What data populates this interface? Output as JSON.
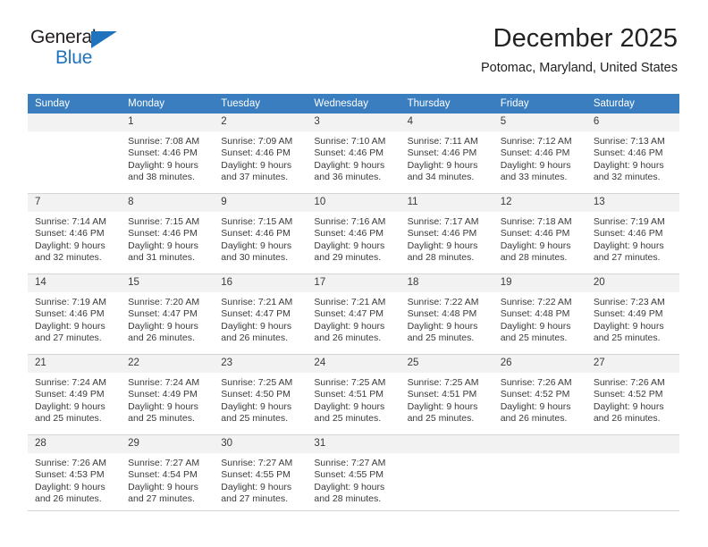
{
  "brand": {
    "name_top": "General",
    "name_bottom": "Blue",
    "triangle_icon": "triangle-icon",
    "color_dark": "#231f20",
    "color_blue": "#1f73bd"
  },
  "header": {
    "month_title": "December 2025",
    "location": "Potomac, Maryland, United States"
  },
  "theme": {
    "header_band": "#3a7ebf",
    "day_number_band": "#f2f2f2",
    "rule": "#d4d4d4",
    "text": "#3a3a3a"
  },
  "weekdays": [
    "Sunday",
    "Monday",
    "Tuesday",
    "Wednesday",
    "Thursday",
    "Friday",
    "Saturday"
  ],
  "labels": {
    "sunrise_prefix": "Sunrise:",
    "sunset_prefix": "Sunset:",
    "daylight_prefix": "Daylight:"
  },
  "weeks": [
    [
      {
        "day": "",
        "sunrise": "",
        "sunset": "",
        "daylight_line1": "",
        "daylight_line2": "",
        "blank": true
      },
      {
        "day": "1",
        "sunrise": "Sunrise: 7:08 AM",
        "sunset": "Sunset: 4:46 PM",
        "daylight_line1": "Daylight: 9 hours",
        "daylight_line2": "and 38 minutes."
      },
      {
        "day": "2",
        "sunrise": "Sunrise: 7:09 AM",
        "sunset": "Sunset: 4:46 PM",
        "daylight_line1": "Daylight: 9 hours",
        "daylight_line2": "and 37 minutes."
      },
      {
        "day": "3",
        "sunrise": "Sunrise: 7:10 AM",
        "sunset": "Sunset: 4:46 PM",
        "daylight_line1": "Daylight: 9 hours",
        "daylight_line2": "and 36 minutes."
      },
      {
        "day": "4",
        "sunrise": "Sunrise: 7:11 AM",
        "sunset": "Sunset: 4:46 PM",
        "daylight_line1": "Daylight: 9 hours",
        "daylight_line2": "and 34 minutes."
      },
      {
        "day": "5",
        "sunrise": "Sunrise: 7:12 AM",
        "sunset": "Sunset: 4:46 PM",
        "daylight_line1": "Daylight: 9 hours",
        "daylight_line2": "and 33 minutes."
      },
      {
        "day": "6",
        "sunrise": "Sunrise: 7:13 AM",
        "sunset": "Sunset: 4:46 PM",
        "daylight_line1": "Daylight: 9 hours",
        "daylight_line2": "and 32 minutes."
      }
    ],
    [
      {
        "day": "7",
        "sunrise": "Sunrise: 7:14 AM",
        "sunset": "Sunset: 4:46 PM",
        "daylight_line1": "Daylight: 9 hours",
        "daylight_line2": "and 32 minutes."
      },
      {
        "day": "8",
        "sunrise": "Sunrise: 7:15 AM",
        "sunset": "Sunset: 4:46 PM",
        "daylight_line1": "Daylight: 9 hours",
        "daylight_line2": "and 31 minutes."
      },
      {
        "day": "9",
        "sunrise": "Sunrise: 7:15 AM",
        "sunset": "Sunset: 4:46 PM",
        "daylight_line1": "Daylight: 9 hours",
        "daylight_line2": "and 30 minutes."
      },
      {
        "day": "10",
        "sunrise": "Sunrise: 7:16 AM",
        "sunset": "Sunset: 4:46 PM",
        "daylight_line1": "Daylight: 9 hours",
        "daylight_line2": "and 29 minutes."
      },
      {
        "day": "11",
        "sunrise": "Sunrise: 7:17 AM",
        "sunset": "Sunset: 4:46 PM",
        "daylight_line1": "Daylight: 9 hours",
        "daylight_line2": "and 28 minutes."
      },
      {
        "day": "12",
        "sunrise": "Sunrise: 7:18 AM",
        "sunset": "Sunset: 4:46 PM",
        "daylight_line1": "Daylight: 9 hours",
        "daylight_line2": "and 28 minutes."
      },
      {
        "day": "13",
        "sunrise": "Sunrise: 7:19 AM",
        "sunset": "Sunset: 4:46 PM",
        "daylight_line1": "Daylight: 9 hours",
        "daylight_line2": "and 27 minutes."
      }
    ],
    [
      {
        "day": "14",
        "sunrise": "Sunrise: 7:19 AM",
        "sunset": "Sunset: 4:46 PM",
        "daylight_line1": "Daylight: 9 hours",
        "daylight_line2": "and 27 minutes."
      },
      {
        "day": "15",
        "sunrise": "Sunrise: 7:20 AM",
        "sunset": "Sunset: 4:47 PM",
        "daylight_line1": "Daylight: 9 hours",
        "daylight_line2": "and 26 minutes."
      },
      {
        "day": "16",
        "sunrise": "Sunrise: 7:21 AM",
        "sunset": "Sunset: 4:47 PM",
        "daylight_line1": "Daylight: 9 hours",
        "daylight_line2": "and 26 minutes."
      },
      {
        "day": "17",
        "sunrise": "Sunrise: 7:21 AM",
        "sunset": "Sunset: 4:47 PM",
        "daylight_line1": "Daylight: 9 hours",
        "daylight_line2": "and 26 minutes."
      },
      {
        "day": "18",
        "sunrise": "Sunrise: 7:22 AM",
        "sunset": "Sunset: 4:48 PM",
        "daylight_line1": "Daylight: 9 hours",
        "daylight_line2": "and 25 minutes."
      },
      {
        "day": "19",
        "sunrise": "Sunrise: 7:22 AM",
        "sunset": "Sunset: 4:48 PM",
        "daylight_line1": "Daylight: 9 hours",
        "daylight_line2": "and 25 minutes."
      },
      {
        "day": "20",
        "sunrise": "Sunrise: 7:23 AM",
        "sunset": "Sunset: 4:49 PM",
        "daylight_line1": "Daylight: 9 hours",
        "daylight_line2": "and 25 minutes."
      }
    ],
    [
      {
        "day": "21",
        "sunrise": "Sunrise: 7:24 AM",
        "sunset": "Sunset: 4:49 PM",
        "daylight_line1": "Daylight: 9 hours",
        "daylight_line2": "and 25 minutes."
      },
      {
        "day": "22",
        "sunrise": "Sunrise: 7:24 AM",
        "sunset": "Sunset: 4:49 PM",
        "daylight_line1": "Daylight: 9 hours",
        "daylight_line2": "and 25 minutes."
      },
      {
        "day": "23",
        "sunrise": "Sunrise: 7:25 AM",
        "sunset": "Sunset: 4:50 PM",
        "daylight_line1": "Daylight: 9 hours",
        "daylight_line2": "and 25 minutes."
      },
      {
        "day": "24",
        "sunrise": "Sunrise: 7:25 AM",
        "sunset": "Sunset: 4:51 PM",
        "daylight_line1": "Daylight: 9 hours",
        "daylight_line2": "and 25 minutes."
      },
      {
        "day": "25",
        "sunrise": "Sunrise: 7:25 AM",
        "sunset": "Sunset: 4:51 PM",
        "daylight_line1": "Daylight: 9 hours",
        "daylight_line2": "and 25 minutes."
      },
      {
        "day": "26",
        "sunrise": "Sunrise: 7:26 AM",
        "sunset": "Sunset: 4:52 PM",
        "daylight_line1": "Daylight: 9 hours",
        "daylight_line2": "and 26 minutes."
      },
      {
        "day": "27",
        "sunrise": "Sunrise: 7:26 AM",
        "sunset": "Sunset: 4:52 PM",
        "daylight_line1": "Daylight: 9 hours",
        "daylight_line2": "and 26 minutes."
      }
    ],
    [
      {
        "day": "28",
        "sunrise": "Sunrise: 7:26 AM",
        "sunset": "Sunset: 4:53 PM",
        "daylight_line1": "Daylight: 9 hours",
        "daylight_line2": "and 26 minutes."
      },
      {
        "day": "29",
        "sunrise": "Sunrise: 7:27 AM",
        "sunset": "Sunset: 4:54 PM",
        "daylight_line1": "Daylight: 9 hours",
        "daylight_line2": "and 27 minutes."
      },
      {
        "day": "30",
        "sunrise": "Sunrise: 7:27 AM",
        "sunset": "Sunset: 4:55 PM",
        "daylight_line1": "Daylight: 9 hours",
        "daylight_line2": "and 27 minutes."
      },
      {
        "day": "31",
        "sunrise": "Sunrise: 7:27 AM",
        "sunset": "Sunset: 4:55 PM",
        "daylight_line1": "Daylight: 9 hours",
        "daylight_line2": "and 28 minutes."
      },
      {
        "day": "",
        "sunrise": "",
        "sunset": "",
        "daylight_line1": "",
        "daylight_line2": "",
        "blank": true
      },
      {
        "day": "",
        "sunrise": "",
        "sunset": "",
        "daylight_line1": "",
        "daylight_line2": "",
        "blank": true
      },
      {
        "day": "",
        "sunrise": "",
        "sunset": "",
        "daylight_line1": "",
        "daylight_line2": "",
        "blank": true
      }
    ]
  ]
}
